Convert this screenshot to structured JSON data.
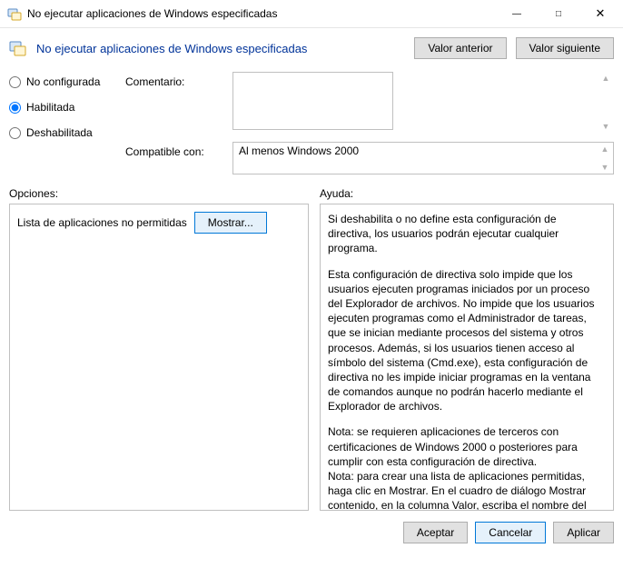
{
  "window": {
    "title": "No ejecutar aplicaciones de Windows especificadas"
  },
  "header": {
    "title": "No ejecutar aplicaciones de Windows especificadas",
    "prev_label": "Valor anterior",
    "next_label": "Valor siguiente"
  },
  "config": {
    "radio": {
      "not_configured": "No configurada",
      "enabled": "Habilitada",
      "disabled": "Deshabilitada",
      "selected": "enabled"
    },
    "comment_label": "Comentario:",
    "comment_value": "",
    "compat_label": "Compatible con:",
    "compat_value": "Al menos Windows 2000"
  },
  "sections": {
    "options_label": "Opciones:",
    "help_label": "Ayuda:"
  },
  "options": {
    "list_label": "Lista de aplicaciones no permitidas",
    "show_button": "Mostrar..."
  },
  "help": {
    "p1": "Si deshabilita o no define esta configuración de directiva, los usuarios podrán ejecutar cualquier programa.",
    "p2": "Esta configuración de directiva solo impide que los usuarios ejecuten programas iniciados por un proceso del Explorador de archivos. No impide que los usuarios ejecuten programas como el Administrador de tareas, que se inician mediante procesos del sistema y otros procesos.  Además, si los usuarios tienen acceso al símbolo del sistema (Cmd.exe), esta configuración de directiva no les impide iniciar programas en la ventana de comandos aunque no podrán hacerlo mediante el Explorador de archivos.",
    "p3": "Nota: se requieren aplicaciones de terceros con certificaciones de Windows 2000 o posteriores para cumplir con esta configuración de directiva.",
    "p4": "Nota: para crear una lista de aplicaciones permitidas, haga clic en Mostrar.  En el cuadro de diálogo Mostrar contenido, en la columna Valor, escriba el nombre del archivo ejecutable de la aplicación (por ejemplo, Winword.exe, Poledit.exe, Powerpnt.exe)."
  },
  "footer": {
    "ok": "Aceptar",
    "cancel": "Cancelar",
    "apply": "Aplicar"
  }
}
